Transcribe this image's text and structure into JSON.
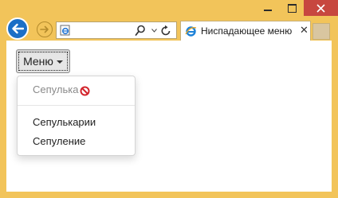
{
  "browser": {
    "address_value": "",
    "tab": {
      "title": "Ниспадающее меню",
      "close_glyph": "✕"
    },
    "icons": {
      "back": "back-arrow-icon",
      "forward": "forward-arrow-icon",
      "search": "search-icon",
      "refresh": "refresh-icon",
      "page": "ie-page-icon"
    }
  },
  "page": {
    "menu_button_label": "Меню",
    "dropdown": {
      "items": [
        {
          "label": "Сепулька",
          "disabled": true
        },
        {
          "label": "Сепулькарии",
          "disabled": false
        },
        {
          "label": "Сепуление",
          "disabled": false
        }
      ]
    },
    "cursor_icon": "not-allowed-cursor-icon"
  },
  "colors": {
    "window_frame": "#f2c45a",
    "close_button": "#c7473f",
    "back_button": "#1b6fc6"
  }
}
